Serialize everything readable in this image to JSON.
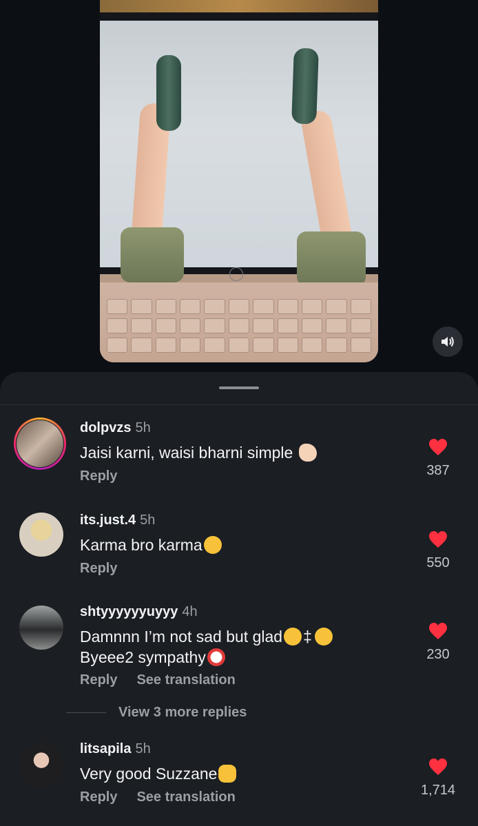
{
  "video": {
    "volume_icon": "speaker-icon"
  },
  "comments": [
    {
      "username": "dolpvzs",
      "time": "5h",
      "text": "Jaisi karni, waisi bharni simple",
      "emoji": "ok-hand-emoji",
      "reply_label": "Reply",
      "likes": "387"
    },
    {
      "username": "its.just.4",
      "time": "5h",
      "text": "Karma bro karma",
      "emoji": "laughing-tears-emoji",
      "reply_label": "Reply",
      "likes": "550"
    },
    {
      "username": "shtyyyyyyuyyy",
      "time": "4h",
      "text_line1": "Damnnn I’m not sad but glad",
      "text_line2": "Byeee2 sympathy",
      "reply_label": "Reply",
      "translate_label": "See translation",
      "likes": "230",
      "view_more": "View 3 more replies"
    },
    {
      "username": "litsapila",
      "time": "5h",
      "text": "Very good Suzzane",
      "emoji": "clapping-hands-emoji",
      "reply_label": "Reply",
      "translate_label": "See translation",
      "likes": "1,714"
    }
  ],
  "colors": {
    "heart": "#ff3040",
    "sheet_bg": "#1b1e23",
    "text_primary": "#f2f3f5",
    "text_secondary": "#9aa0a6"
  }
}
